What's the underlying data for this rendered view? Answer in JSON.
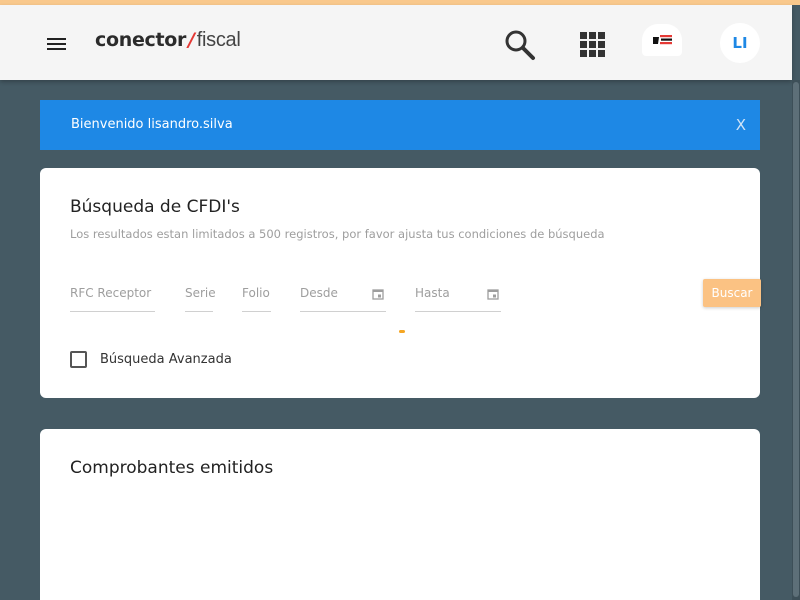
{
  "header": {
    "logo_bold": "conector",
    "logo_slash": "/",
    "logo_light": "fiscal",
    "avatar_initials": "LI"
  },
  "icons": {
    "menu": "hamburger-menu-icon",
    "search": "search-icon",
    "apps": "apps-grid-icon",
    "company": "company-logo-icon",
    "calendar": "calendar-icon"
  },
  "welcome": {
    "message": "Bienvenido lisandro.silva",
    "close_label": "X"
  },
  "search_card": {
    "title": "Búsqueda de CFDI's",
    "subtitle": "Los resultados estan limitados a 500 registros, por favor ajusta tus condiciones de búsqueda",
    "fields": {
      "rfc": "RFC Receptor",
      "serie": "Serie",
      "folio": "Folio",
      "desde": "Desde",
      "hasta": "Hasta"
    },
    "search_button": "Buscar",
    "advanced_label": "Búsqueda Avanzada",
    "advanced_checked": false
  },
  "emitted_card": {
    "title": "Comprobantes emitidos"
  },
  "colors": {
    "background": "#455a64",
    "appbar": "#f5f5f5",
    "welcome": "#1e88e5",
    "accent": "#fbc283",
    "avatar_text": "#1e88e5",
    "logo_slash": "#e53935"
  }
}
